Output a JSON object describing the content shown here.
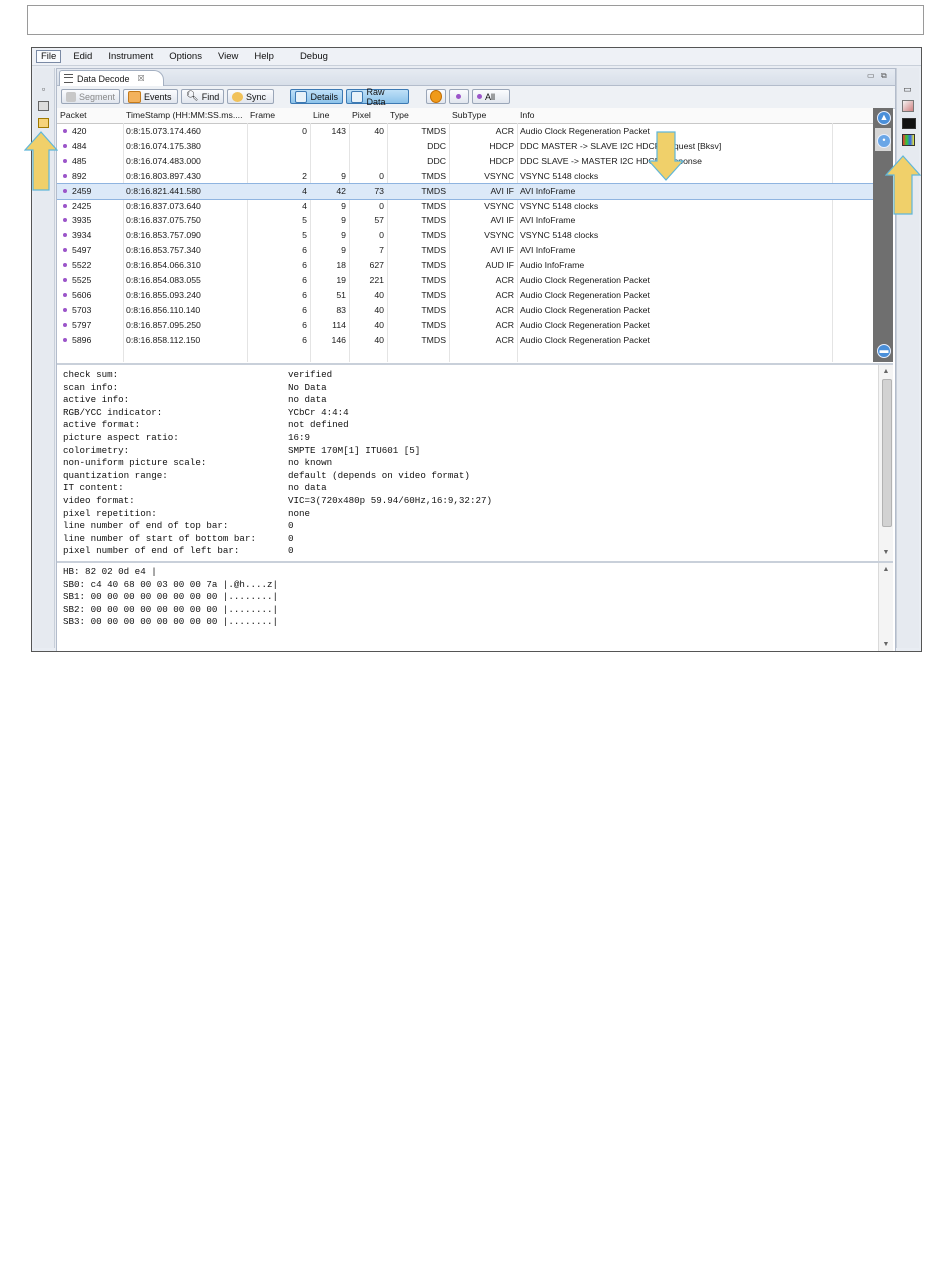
{
  "menu": [
    "File",
    "Edid",
    "Instrument",
    "Options",
    "View",
    "Help",
    "Debug"
  ],
  "view_tab": {
    "title": "Data Decode",
    "close": "☒"
  },
  "toolbar": {
    "segment": "Segment",
    "events": "Events",
    "find": "Find",
    "sync": "Sync",
    "details": "Details",
    "raw_data": "Raw Data",
    "all": "All"
  },
  "table": {
    "columns": [
      "Packet",
      "TimeStamp (HH:MM:SS.ms....",
      "Frame",
      "Line",
      "Pixel",
      "Type",
      "SubType",
      "Info"
    ],
    "rows": [
      [
        "420",
        "0:8:15.073.174.460",
        "0",
        "143",
        "40",
        "TMDS",
        "ACR",
        "Audio Clock Regeneration Packet"
      ],
      [
        "484",
        "0:8:16.074.175.380",
        "",
        "",
        "",
        "DDC",
        "HDCP",
        "DDC MASTER -> SLAVE I2C HDCP Request [Bksv]"
      ],
      [
        "485",
        "0:8:16.074.483.000",
        "",
        "",
        "",
        "DDC",
        "HDCP",
        "DDC SLAVE -> MASTER I2C HDCP Response"
      ],
      [
        "892",
        "0:8:16.803.897.430",
        "2",
        "9",
        "0",
        "TMDS",
        "VSYNC",
        "VSYNC 5148 clocks"
      ],
      [
        "2459",
        "0:8:16.821.441.580",
        "4",
        "42",
        "73",
        "TMDS",
        "AVI IF",
        "AVI InfoFrame"
      ],
      [
        "2425",
        "0:8:16.837.073.640",
        "4",
        "9",
        "0",
        "TMDS",
        "VSYNC",
        "VSYNC 5148 clocks"
      ],
      [
        "3935",
        "0:8:16.837.075.750",
        "5",
        "9",
        "57",
        "TMDS",
        "AVI IF",
        "AVI InfoFrame"
      ],
      [
        "3934",
        "0:8:16.853.757.090",
        "5",
        "9",
        "0",
        "TMDS",
        "VSYNC",
        "VSYNC 5148 clocks"
      ],
      [
        "5497",
        "0:8:16.853.757.340",
        "6",
        "9",
        "7",
        "TMDS",
        "AVI IF",
        "AVI InfoFrame"
      ],
      [
        "5522",
        "0:8:16.854.066.310",
        "6",
        "18",
        "627",
        "TMDS",
        "AUD IF",
        "Audio InfoFrame"
      ],
      [
        "5525",
        "0:8:16.854.083.055",
        "6",
        "19",
        "221",
        "TMDS",
        "ACR",
        "Audio Clock Regeneration Packet"
      ],
      [
        "5606",
        "0:8:16.855.093.240",
        "6",
        "51",
        "40",
        "TMDS",
        "ACR",
        "Audio Clock Regeneration Packet"
      ],
      [
        "5703",
        "0:8:16.856.110.140",
        "6",
        "83",
        "40",
        "TMDS",
        "ACR",
        "Audio Clock Regeneration Packet"
      ],
      [
        "5797",
        "0:8:16.857.095.250",
        "6",
        "114",
        "40",
        "TMDS",
        "ACR",
        "Audio Clock Regeneration Packet"
      ],
      [
        "5896",
        "0:8:16.858.112.150",
        "6",
        "146",
        "40",
        "TMDS",
        "ACR",
        "Audio Clock Regeneration Packet"
      ]
    ],
    "selected_index": 4
  },
  "details": [
    [
      "check sum:",
      "verified"
    ],
    [
      "scan info:",
      "No Data"
    ],
    [
      "active info:",
      "no data"
    ],
    [
      "RGB/YCC indicator:",
      "YCbCr 4:4:4"
    ],
    [
      "active format:",
      "not defined"
    ],
    [
      "picture aspect ratio:",
      "16:9"
    ],
    [
      "colorimetry:",
      "SMPTE 170M[1] ITU601 [5]"
    ],
    [
      "non-uniform picture scale:",
      "no known"
    ],
    [
      "quantization range:",
      "default (depends on video format)"
    ],
    [
      "IT content:",
      "no data"
    ],
    [
      "video format:",
      "VIC=3(720x480p 59.94/60Hz,16:9,32:27)"
    ],
    [
      "pixel repetition:",
      "none"
    ],
    [
      "line number of end of top bar:",
      "0"
    ],
    [
      "line number of start of bottom bar:",
      "0"
    ],
    [
      "pixel number of end of left bar:",
      "0"
    ]
  ],
  "raw": [
    "HB: 82 02 0d e4 |",
    "SB0: c4 40 68 00 03 00 00 7a |.@h....z|",
    "SB1: 00 00 00 00 00 00 00 00 |........|",
    "SB2: 00 00 00 00 00 00 00 00 |........|",
    "SB3: 00 00 00 00 00 00 00 00 |........|"
  ],
  "colors": {
    "accent": "#4a8fd9",
    "callout_arrow": "#f0d06a",
    "selection": "#dce9f8"
  }
}
